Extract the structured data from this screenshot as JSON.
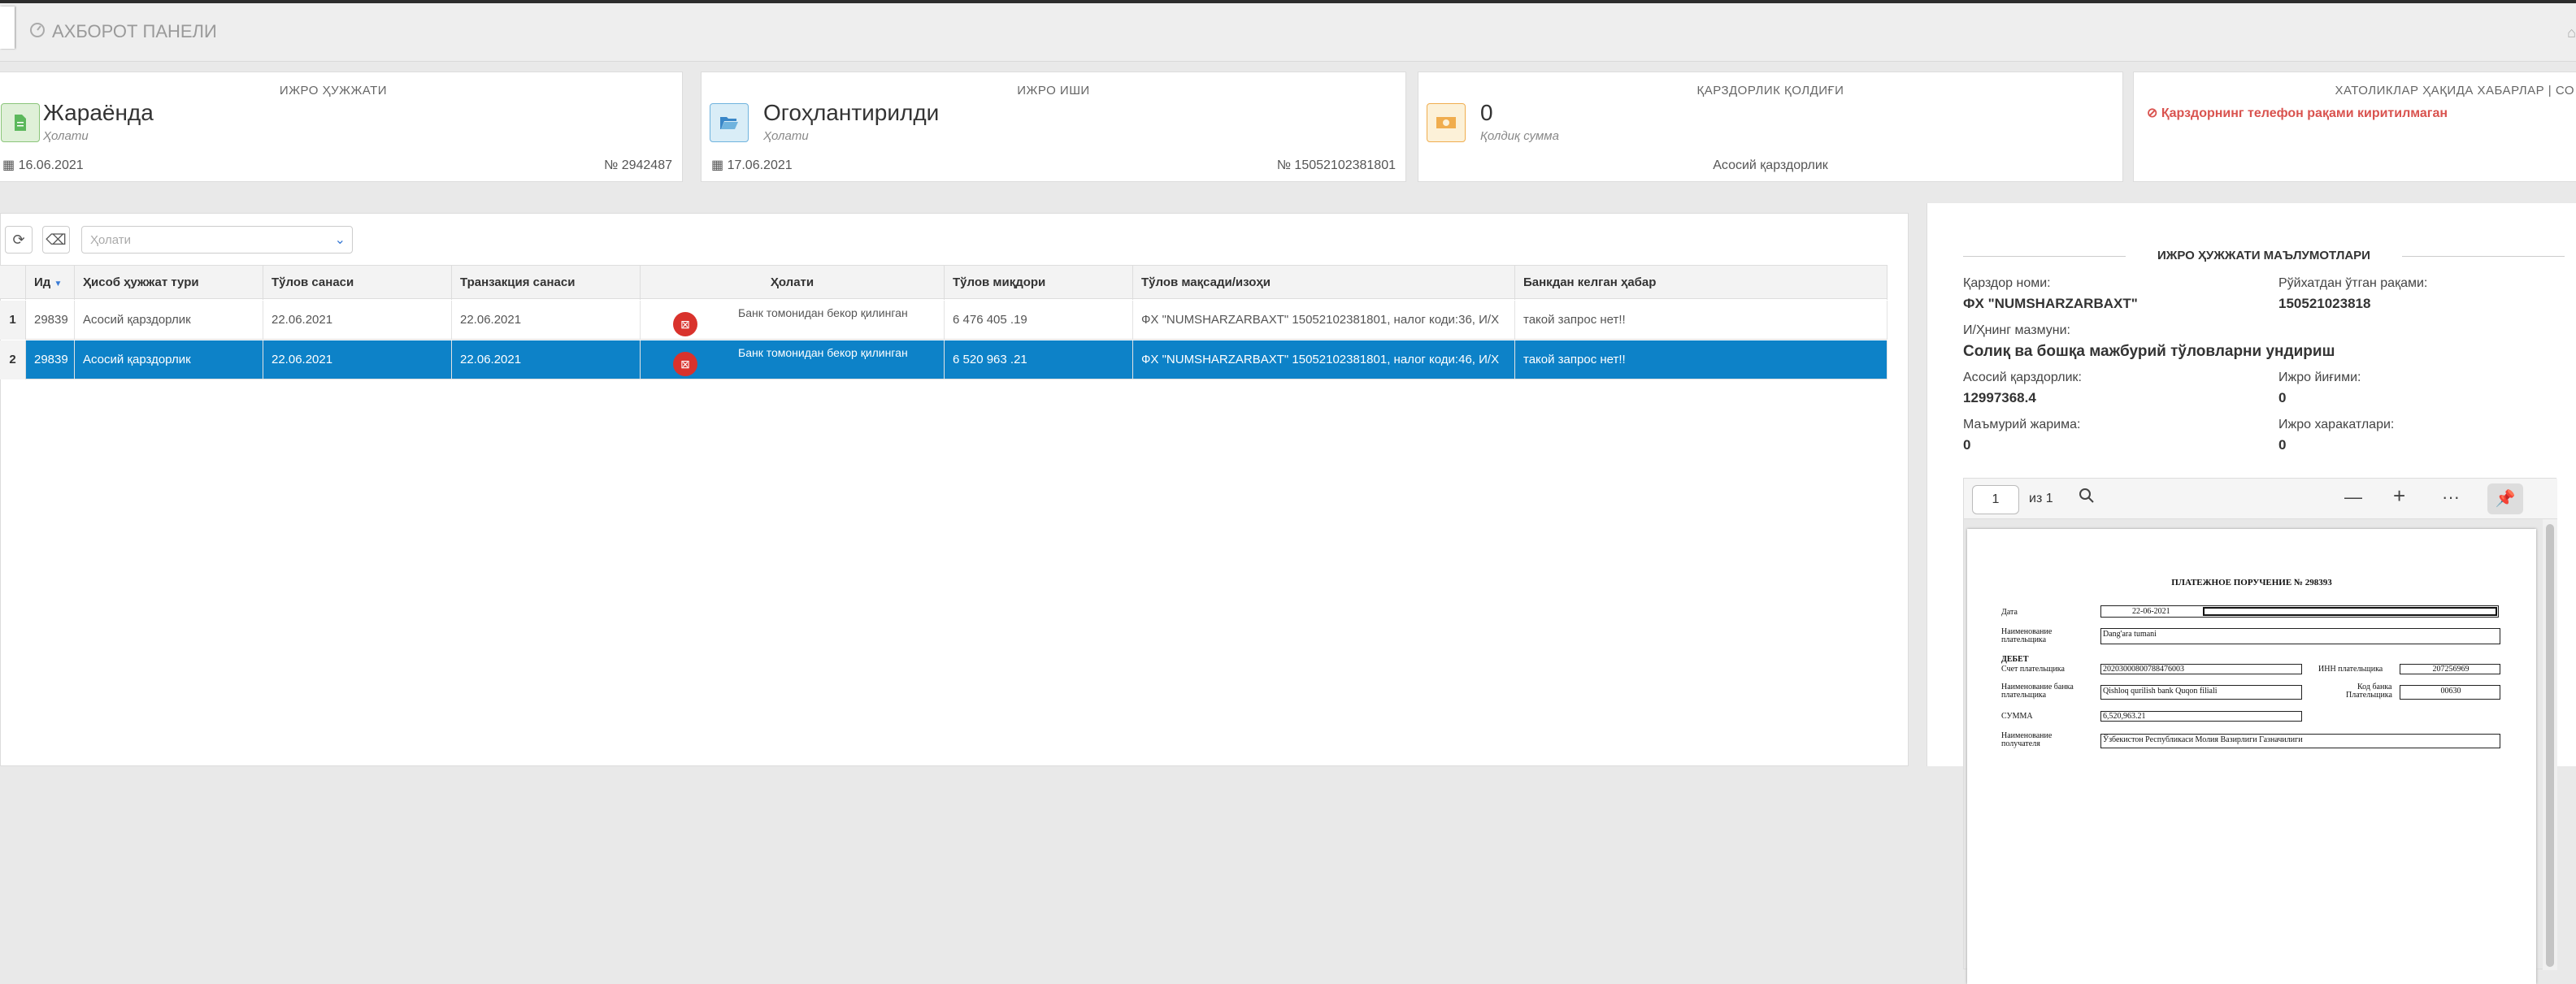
{
  "header": {
    "title": "АХБОРОТ ПАНЕЛИ"
  },
  "cards": [
    {
      "title": "ИЖРО ҲУЖЖАТИ",
      "value": "Жараёнда",
      "sub": "Ҳолати",
      "date": "16.06.2021",
      "number": "№ 2942487",
      "icon": "document-icon"
    },
    {
      "title": "ИЖРО ИШИ",
      "value": "Огоҳлантирилди",
      "sub": "Ҳолати",
      "date": "17.06.2021",
      "number": "№ 15052102381801",
      "icon": "folder-open-icon"
    },
    {
      "title": "ҚАРЗДОРЛИК ҚОЛДИҒИ",
      "value": "0",
      "sub": "Қолдиқ сумма",
      "footer": "Асосий қарздорлик",
      "icon": "money-icon"
    },
    {
      "title": "ХАТОЛИКЛАР ҲАҚИДА ХАБАРЛАР | СО",
      "message": "Қарздорнинг телефон рақами киритилмаган"
    }
  ],
  "toolbar": {
    "status_placeholder": "Ҳолати"
  },
  "table": {
    "columns": [
      "Ид",
      "Ҳисоб ҳужжат тури",
      "Тўлов санаси",
      "Транзакция санаси",
      "Ҳолати",
      "Тўлов миқдори",
      "Тўлов мақсади/изоҳи",
      "Банкдан келган ҳабар"
    ],
    "rows": [
      {
        "n": "1",
        "id": "29839",
        "type": "Асосий қарздорлик",
        "pay_date": "22.06.2021",
        "tr_date": "22.06.2021",
        "status": "Банк томонидан бекор қилинган",
        "amount": "6 476 405 .19",
        "purpose": "ФХ \"NUMSHARZARBAXT\" 15052102381801, налог коди:36, И/Х",
        "bank_msg": "такой запрос нет!!"
      },
      {
        "n": "2",
        "id": "29839",
        "type": "Асосий қарздорлик",
        "pay_date": "22.06.2021",
        "tr_date": "22.06.2021",
        "status": "Банк томонидан бекор қилинган",
        "amount": "6 520 963 .21",
        "purpose": "ФХ \"NUMSHARZARBAXT\" 15052102381801, налог коди:46, И/Х",
        "bank_msg": "такой запрос нет!!"
      }
    ]
  },
  "details": {
    "section_title": "ИЖРО ҲУЖЖАТИ МАЪЛУМОТЛАРИ",
    "debtor_label": "Қарздор номи:",
    "debtor_value": "ФХ \"NUMSHARZARBAXT\"",
    "reg_label": "Рўйхатдан ўтган рақами:",
    "reg_value": "150521023818",
    "content_label": "И/Ҳнинг мазмуни:",
    "content_value": "Солиқ ва бошқа мажбурий тўловларни ундириш",
    "main_debt_label": "Асосий қарздорлик:",
    "main_debt_value": "12997368.4",
    "fee_label": "Ижро йиғими:",
    "fee_value": "0",
    "fine_label": "Маъмурий жарима:",
    "fine_value": "0",
    "actions_label": "Ижро харакатлари:",
    "actions_value": "0"
  },
  "pdf": {
    "page": "1",
    "of": "из 1",
    "title": "ПЛАТЕЖНОЕ ПОРУЧЕНИЕ № 298393",
    "date_label": "Дата",
    "date_value": "22-06-2021",
    "payer_label_1": "Наименование",
    "payer_label_2": "плательщика",
    "payer_value": "Dang'ara tumani",
    "debit_label": "ДЕБЕТ",
    "account_label": "Счет плательщика",
    "account_value": "20203000800788476003",
    "inn_label": "ИНН плательщика",
    "inn_value": "207256969",
    "bank_label_1": "Наименование банка",
    "bank_label_2": "плательщика",
    "bank_value": "Qishloq qurilish bank Quqon filiali",
    "bank_code_label_1": "Код банка",
    "bank_code_label_2": "Плательщика",
    "bank_code_value": "00630",
    "sum_label": "СУММА",
    "sum_value": "6,520,963.21",
    "receiver_label_1": "Наименование",
    "receiver_label_2": "получателя",
    "receiver_value": "Ўзбекистон Республикаси Молия Вазирлиги Газначилиги"
  }
}
